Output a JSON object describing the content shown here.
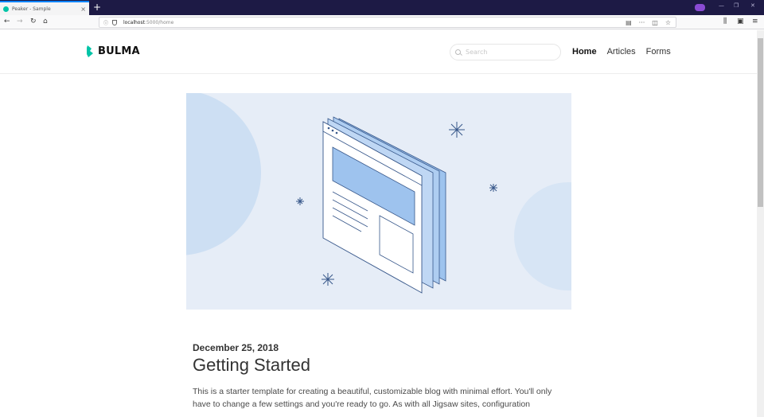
{
  "browser": {
    "tab_title": "Peaker - Sample",
    "tab_close": "×",
    "new_tab": "+",
    "url_host": "localhost",
    "url_path": ":5000/home",
    "window_controls": [
      "—",
      "❐",
      "✕"
    ]
  },
  "site": {
    "brand": "BULMA",
    "search_placeholder": "Search",
    "nav": [
      {
        "label": "Home",
        "active": true
      },
      {
        "label": "Articles",
        "active": false
      },
      {
        "label": "Forms",
        "active": false
      }
    ]
  },
  "post": {
    "date": "December 25, 2018",
    "title": "Getting Started",
    "excerpt": "This is a starter template for creating a beautiful, customizable blog with minimal effort. You'll only have to change a few settings and you're ready to go. As with all Jigsaw sites, configuration"
  },
  "colors": {
    "accent": "#00c4a7",
    "hero_bg": "#e6edf7",
    "tab_bar": "#1d1a45"
  }
}
